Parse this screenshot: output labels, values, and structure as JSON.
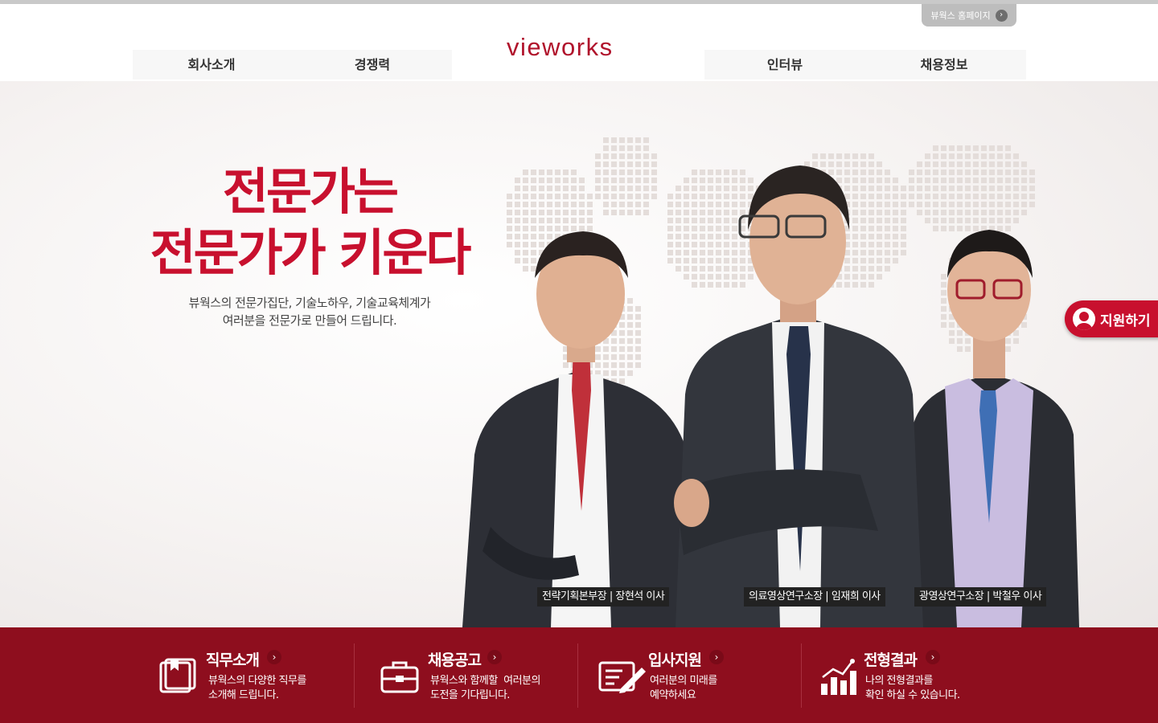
{
  "header": {
    "home_link": "뷰웍스 홈페이지",
    "logo": "VIEWORKS",
    "nav": [
      "회사소개",
      "경쟁력",
      "인터뷰",
      "채용정보"
    ]
  },
  "hero": {
    "headline_line1": "전문가는",
    "headline_line2": "전문가가 키운다",
    "sub_line1": "뷰웍스의 전문가집단, 기술노하우, 기술교육체계가",
    "sub_line2": "여러분을 전문가로 만들어 드립니다.",
    "people": [
      {
        "caption": "전략기획본부장 | 장현석 이사"
      },
      {
        "caption": "의료영상연구소장 | 임재희 이사"
      },
      {
        "caption": "광영상연구소장 | 박철우 이사"
      }
    ]
  },
  "apply_button": "지원하기",
  "footer": {
    "cards": [
      {
        "title": "직무소개",
        "desc_line1": "뷰웍스의 다양한 직무를",
        "desc_line2": "소개해 드립니다.",
        "icon": "book-icon"
      },
      {
        "title": "채용공고",
        "desc_line1": "뷰웍스와 함께할  여러분의",
        "desc_line2": "도전을 기다립니다.",
        "icon": "briefcase-icon"
      },
      {
        "title": "입사지원",
        "desc_line1": "여러분의 미래를",
        "desc_line2": "예약하세요",
        "icon": "edit-document-icon"
      },
      {
        "title": "전형결과",
        "desc_line1": "나의 전형결과를",
        "desc_line2": "확인 하실 수 있습니다.",
        "icon": "bar-chart-icon"
      }
    ]
  },
  "colors": {
    "brand": "#c8102e",
    "footer_bg": "#8e0e1e",
    "caption_bg": "#222222"
  }
}
